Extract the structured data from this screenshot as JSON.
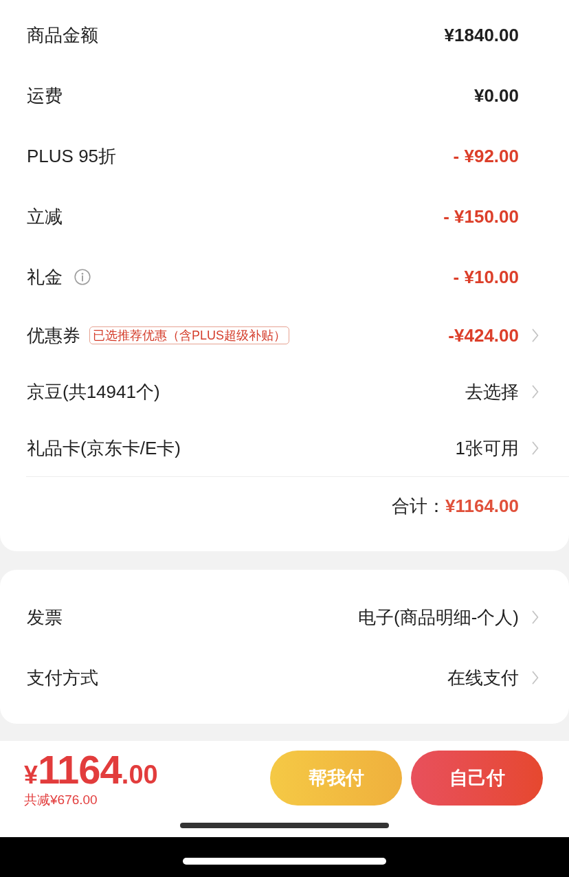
{
  "price_details": {
    "rows": [
      {
        "label": "商品金额",
        "value": "¥1840.00",
        "kind": "amount"
      },
      {
        "label": "运费",
        "value": "¥0.00",
        "kind": "amount"
      },
      {
        "label": "PLUS 95折",
        "value": "- ¥92.00",
        "kind": "discount"
      },
      {
        "label": "立减",
        "value": "- ¥150.00",
        "kind": "discount"
      },
      {
        "label": "礼金",
        "value": "- ¥10.00",
        "kind": "discount",
        "info": true
      },
      {
        "label": "优惠券",
        "badge": "已选推荐优惠（含PLUS超级补贴）",
        "value": "-¥424.00",
        "kind": "coupon"
      },
      {
        "label": "京豆(共14941个)",
        "value": "去选择",
        "kind": "choice"
      },
      {
        "label": "礼品卡(京东卡/E卡)",
        "value": "1张可用",
        "kind": "choice"
      }
    ],
    "total": {
      "label": "合计：",
      "value": "¥1164.00"
    }
  },
  "order_options": {
    "rows": [
      {
        "label": "发票",
        "value": "电子(商品明细-个人)",
        "kind": "choice"
      },
      {
        "label": "支付方式",
        "value": "在线支付",
        "kind": "choice"
      }
    ]
  },
  "checkout_bar": {
    "price": {
      "currency": "¥",
      "integer": "1164",
      "decimal": ".00"
    },
    "savings": "共减¥676.00",
    "buttons": [
      {
        "label": "帮我付",
        "kind": "secondary"
      },
      {
        "label": "自己付",
        "kind": "primary"
      }
    ]
  }
}
